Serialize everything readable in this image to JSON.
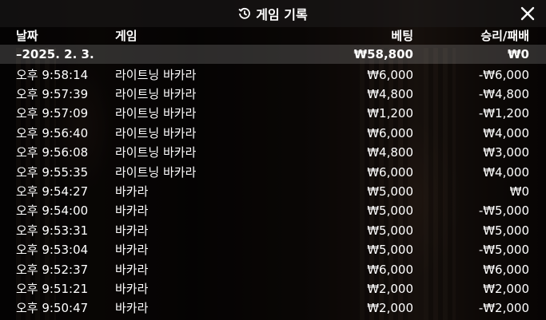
{
  "header": {
    "title": "게임 기록",
    "history_icon": "history-icon",
    "close_icon": "close-icon"
  },
  "columns": {
    "time": "날짜",
    "game": "게임",
    "bet": "베팅",
    "result": "승리/패배"
  },
  "date_group": {
    "date": "–2025. 2. 3.",
    "total_bet": "₩58,800",
    "total_result": "₩0"
  },
  "rows": [
    {
      "time": "오후 9:58:14",
      "game": "라이트닝 바카라",
      "bet": "₩6,000",
      "result": "-₩6,000"
    },
    {
      "time": "오후 9:57:39",
      "game": "라이트닝 바카라",
      "bet": "₩4,800",
      "result": "-₩4,800"
    },
    {
      "time": "오후 9:57:09",
      "game": "라이트닝 바카라",
      "bet": "₩1,200",
      "result": "-₩1,200"
    },
    {
      "time": "오후 9:56:40",
      "game": "라이트닝 바카라",
      "bet": "₩6,000",
      "result": "₩4,000"
    },
    {
      "time": "오후 9:56:08",
      "game": "라이트닝 바카라",
      "bet": "₩4,800",
      "result": "₩3,000"
    },
    {
      "time": "오후 9:55:35",
      "game": "라이트닝 바카라",
      "bet": "₩6,000",
      "result": "₩4,000"
    },
    {
      "time": "오후 9:54:27",
      "game": "바카라",
      "bet": "₩5,000",
      "result": "₩0"
    },
    {
      "time": "오후 9:54:00",
      "game": "바카라",
      "bet": "₩5,000",
      "result": "-₩5,000"
    },
    {
      "time": "오후 9:53:31",
      "game": "바카라",
      "bet": "₩5,000",
      "result": "₩5,000"
    },
    {
      "time": "오후 9:53:04",
      "game": "바카라",
      "bet": "₩5,000",
      "result": "-₩5,000"
    },
    {
      "time": "오후 9:52:37",
      "game": "바카라",
      "bet": "₩6,000",
      "result": "₩6,000"
    },
    {
      "time": "오후 9:51:21",
      "game": "바카라",
      "bet": "₩2,000",
      "result": "₩2,000"
    },
    {
      "time": "오후 9:50:47",
      "game": "바카라",
      "bet": "₩2,000",
      "result": "-₩2,000"
    }
  ]
}
